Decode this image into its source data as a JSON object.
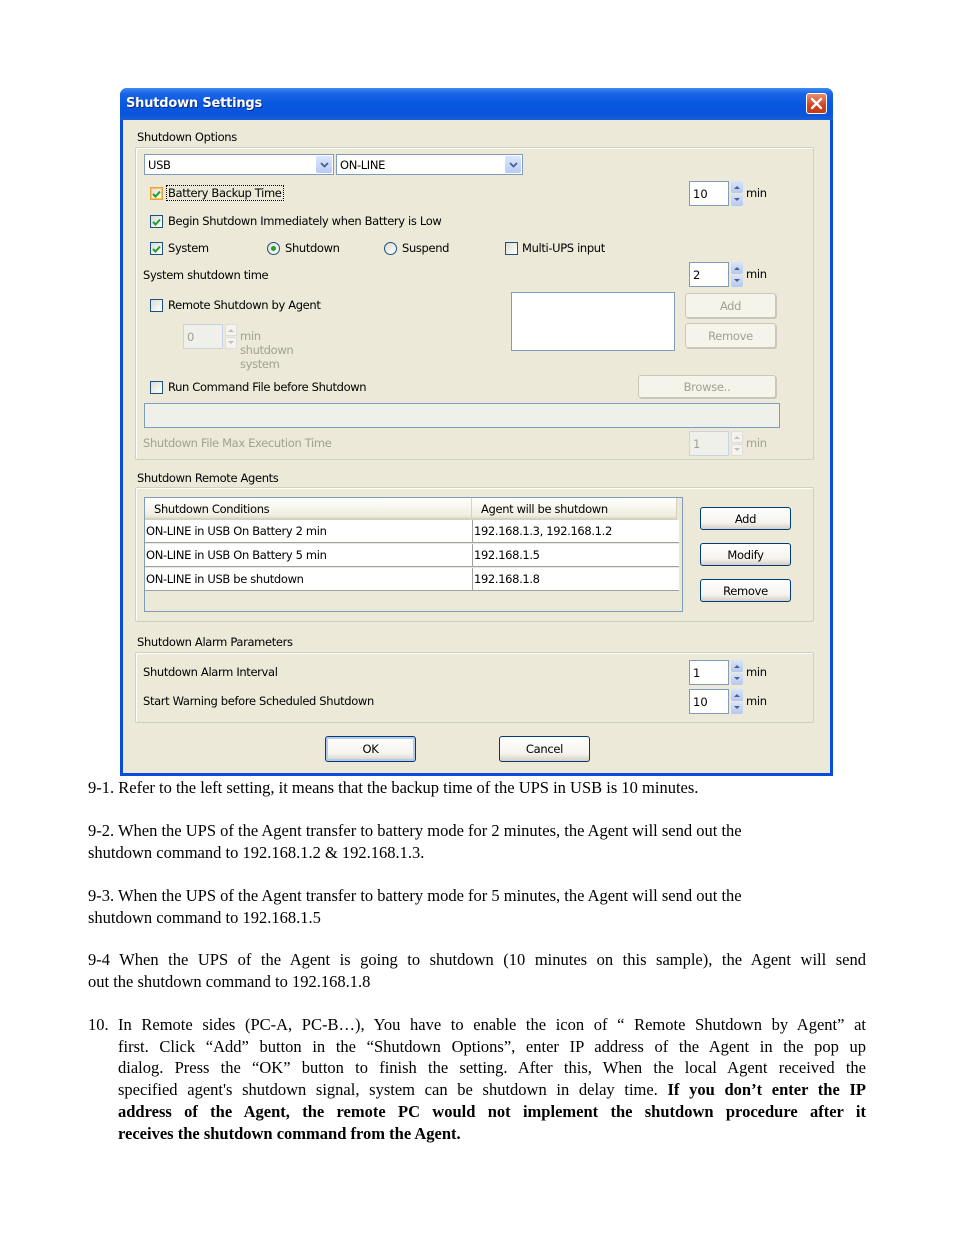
{
  "dialog": {
    "title": "Shutdown Settings",
    "shutdown_options": {
      "group_label": "Shutdown Options",
      "port_select": "USB",
      "ups_select": "ON-LINE",
      "battery_backup_time": {
        "label": "Battery Backup Time",
        "checked": true,
        "value": "10",
        "unit": "min"
      },
      "begin_shutdown_low_battery": {
        "label": "Begin Shutdown Immediately when Battery is Low",
        "checked": true
      },
      "system": {
        "label": "System",
        "checked": true
      },
      "radio_shutdown": {
        "label": "Shutdown",
        "selected": true
      },
      "radio_suspend": {
        "label": "Suspend",
        "selected": false
      },
      "multi_ups_input": {
        "label": "Multi-UPS input",
        "checked": false
      },
      "system_shutdown_time": {
        "label": "System shutdown time",
        "value": "2",
        "unit": "min"
      },
      "remote_shutdown_by_agent": {
        "label": "Remote Shutdown by Agent",
        "checked": false,
        "delay_value": "0",
        "delay_label": "min shutdown system"
      },
      "agent_add_button": "Add",
      "agent_remove_button": "Remove",
      "run_command_file": {
        "label": "Run Command File before Shutdown",
        "checked": false
      },
      "browse_button": "Browse..",
      "command_file_path": "",
      "max_execution_time": {
        "label": "Shutdown File Max Execution Time",
        "value": "1",
        "unit": "min"
      }
    },
    "remote_agents": {
      "group_label": "Shutdown Remote Agents",
      "columns": [
        "Shutdown Conditions",
        "Agent will be shutdown"
      ],
      "rows": [
        [
          "ON-LINE in USB On Battery 2 min",
          "192.168.1.3, 192.168.1.2"
        ],
        [
          "ON-LINE in USB On Battery 5 min",
          "192.168.1.5"
        ],
        [
          "ON-LINE in USB be shutdown",
          "192.168.1.8"
        ]
      ],
      "add_button": "Add",
      "modify_button": "Modify",
      "remove_button": "Remove"
    },
    "alarm": {
      "group_label": "Shutdown Alarm Parameters",
      "interval": {
        "label": "Shutdown Alarm Interval",
        "value": "1",
        "unit": "min"
      },
      "warning": {
        "label": "Start Warning before Scheduled Shutdown",
        "value": "10",
        "unit": "min"
      }
    },
    "ok_button": "OK",
    "cancel_button": "Cancel"
  },
  "document": {
    "p9_1": "9-1. Refer to the left setting, it means that the backup time of the UPS in USB is 10 minutes.",
    "p9_2a": "9-2. When the UPS of the Agent transfer to battery mode for 2 minutes, the Agent will send out the",
    "p9_2b": "shutdown command to 192.168.1.2 & 192.168.1.3.",
    "p9_3a": "9-3. When the UPS of the Agent transfer to battery mode for 5 minutes, the Agent will send out the",
    "p9_3b": "shutdown command to 192.168.1.5",
    "p9_4a": "9-4 When the UPS of the Agent is going to shutdown (10 minutes on this sample), the Agent will send",
    "p9_4b": "out the shutdown command to 192.168.1.8",
    "p10_num": "10.",
    "p10_l1": "In Remote sides (PC-A, PC-B…), You have to enable the icon of “ Remote Shutdown by Agent” at",
    "p10_l2": "first. Click “Add” button in the “Shutdown Options”, enter IP address of the Agent in the pop up",
    "p10_l3": "dialog. Press the “OK” button to finish the setting. After this, When the local Agent received the",
    "p10_l4_plain": "specified agent's shutdown signal, system can be shutdown in delay time. ",
    "p10_l4_bold": "If you don’t enter the IP",
    "p10_l5": "address of the Agent, the remote PC would not implement the shutdown procedure after it",
    "p10_l6": "receives the shutdown command from the Agent."
  }
}
